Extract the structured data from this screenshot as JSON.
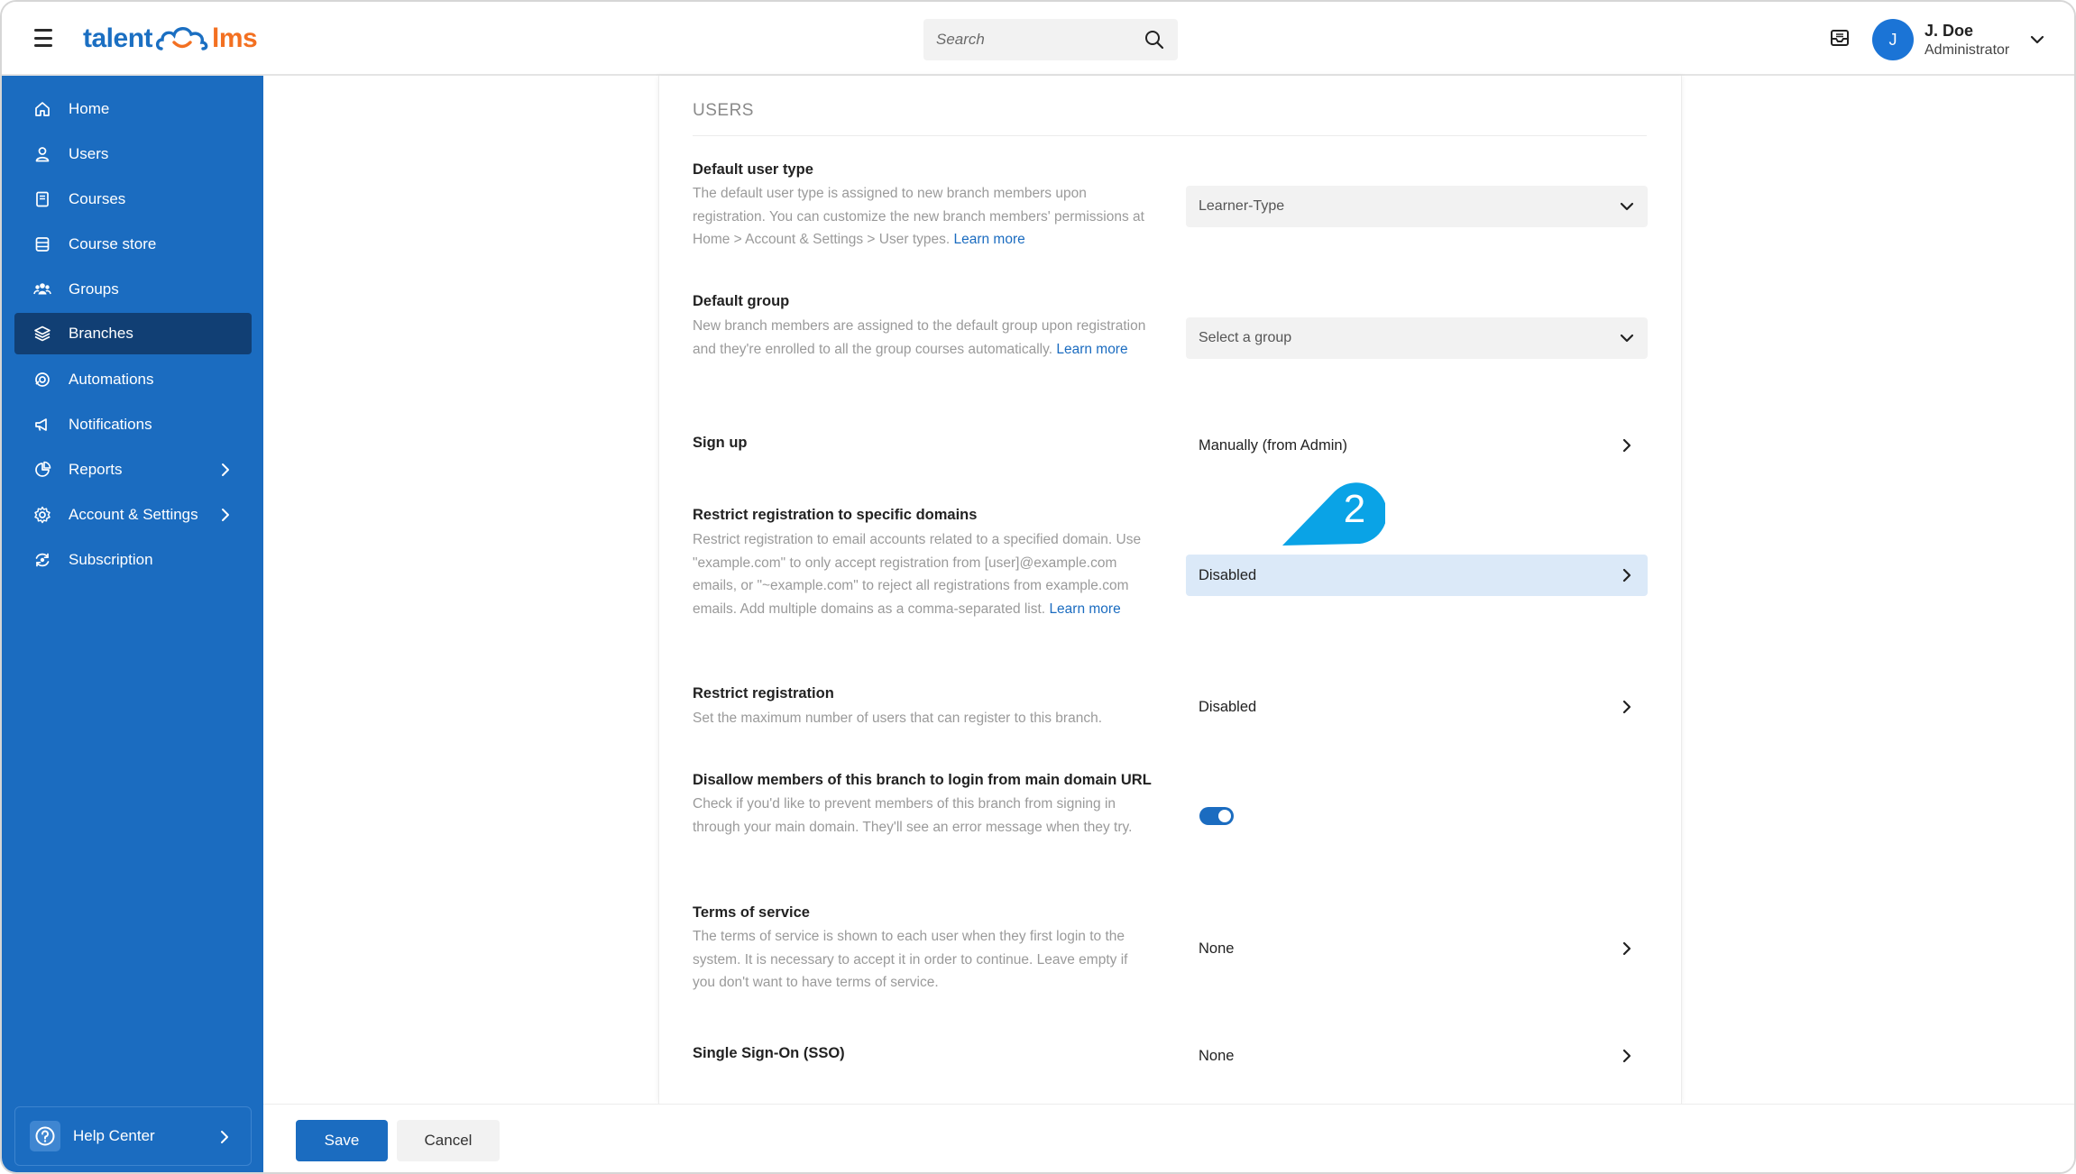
{
  "header": {
    "logo_left": "talent",
    "logo_right": "lms",
    "search_placeholder": "Search",
    "user_initial": "J",
    "user_name": "J. Doe",
    "user_role": "Administrator"
  },
  "sidebar": {
    "items": [
      {
        "label": "Home",
        "icon": "home-icon"
      },
      {
        "label": "Users",
        "icon": "user-icon"
      },
      {
        "label": "Courses",
        "icon": "book-icon"
      },
      {
        "label": "Course store",
        "icon": "store-icon"
      },
      {
        "label": "Groups",
        "icon": "groups-icon"
      },
      {
        "label": "Branches",
        "icon": "branches-icon",
        "active": true
      },
      {
        "label": "Automations",
        "icon": "automations-icon"
      },
      {
        "label": "Notifications",
        "icon": "megaphone-icon"
      },
      {
        "label": "Reports",
        "icon": "pie-chart-icon",
        "expandable": true
      },
      {
        "label": "Account & Settings",
        "icon": "gear-icon",
        "expandable": true
      },
      {
        "label": "Subscription",
        "icon": "subscription-icon"
      }
    ],
    "help_label": "Help Center"
  },
  "section": {
    "title": "USERS"
  },
  "settings": {
    "default_user_type": {
      "label": "Default user type",
      "desc": "The default user type is assigned to new branch members upon registration. You can customize the new branch members' permissions at Home > Account & Settings > User types.",
      "link": "Learn more",
      "value": "Learner-Type"
    },
    "default_group": {
      "label": "Default group",
      "desc": "New branch members are assigned to the default group upon registration and they're enrolled to all the group courses automatically.",
      "link": "Learn more",
      "value": "Select a group"
    },
    "sign_up": {
      "label": "Sign up",
      "value": "Manually (from Admin)"
    },
    "restrict_domains": {
      "label": "Restrict registration to specific domains",
      "desc": "Restrict registration to email accounts related to a specified domain. Use \"example.com\" to only accept registration from [user]@example.com emails, or \"~example.com\" to reject all registrations from example.com emails. Add multiple domains as a comma-separated list.",
      "link": "Learn more",
      "value": "Disabled"
    },
    "restrict_registration": {
      "label": "Restrict registration",
      "desc": "Set the maximum number of users that can register to this branch.",
      "value": "Disabled"
    },
    "disallow_login": {
      "label": "Disallow members of this branch to login from main domain URL",
      "desc": "Check if you'd like to prevent members of this branch from signing in through your main domain. They'll see an error message when they try.",
      "enabled": true
    },
    "terms": {
      "label": "Terms of service",
      "desc": "The terms of service is shown to each user when they first login to the system. It is necessary to accept it in order to continue. Leave empty if you don't want to have terms of service.",
      "value": "None"
    },
    "sso": {
      "label": "Single Sign-On (SSO)",
      "value": "None"
    }
  },
  "callout": {
    "number": "2",
    "color": "#0aa3e6"
  },
  "footer": {
    "save_label": "Save",
    "cancel_label": "Cancel"
  },
  "colors": {
    "brand_blue": "#1b6cc0",
    "active_nav": "#113f74",
    "logo_orange": "#f37021",
    "highlight_row": "#dbe9f8"
  }
}
